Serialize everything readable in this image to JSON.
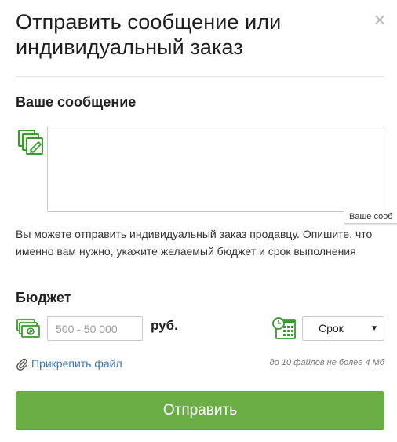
{
  "dialog": {
    "title": "Отправить сообщение или индивидуальный заказ",
    "close_glyph": "×"
  },
  "message": {
    "label": "Ваше сообщение",
    "value": "",
    "tooltip": "Ваше сооб",
    "hint": "Вы можете отправить индивидуальный заказ продавцу. Опишите, что именно вам нужно, укажите желаемый бюджет и срок выполнения"
  },
  "budget": {
    "label": "Бюджет",
    "placeholder": "500 - 50 000",
    "currency": "руб.",
    "deadline_selected": "Срок"
  },
  "attachment": {
    "link_text": "Прикрепить файл",
    "limit_text": "до 10 файлов не более 4 Мб"
  },
  "submit_label": "Отправить",
  "icons": {
    "message": "message-edit-icon",
    "money": "money-icon",
    "calendar": "calendar-clock-icon",
    "attach": "paperclip-icon",
    "close": "close-icon",
    "caret": "chevron-down-icon"
  },
  "colors": {
    "accent_green": "#6bae45",
    "icon_green": "#3a9a2e",
    "link_blue": "#3d76b8"
  }
}
